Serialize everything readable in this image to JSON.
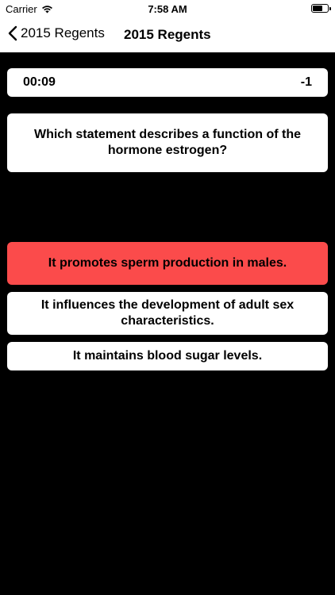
{
  "status_bar": {
    "carrier": "Carrier",
    "time": "7:58 AM",
    "wifi_icon": "wifi-icon",
    "battery_icon": "battery-icon"
  },
  "nav": {
    "back_label": "2015 Regents",
    "back_icon": "chevron-left-icon",
    "title": "2015 Regents"
  },
  "timer": {
    "elapsed": "00:09",
    "score": "-1"
  },
  "question": {
    "text": "Which statement describes a function of the hormone estrogen?"
  },
  "answers": [
    {
      "text": "It promotes sperm production in males.",
      "state": "incorrect"
    },
    {
      "text": "It influences the development of adult sex characteristics.",
      "state": "default"
    },
    {
      "text": "It maintains blood sugar levels.",
      "state": "default"
    }
  ],
  "colors": {
    "background": "#000000",
    "card": "#ffffff",
    "incorrect": "#fb4b4b"
  }
}
